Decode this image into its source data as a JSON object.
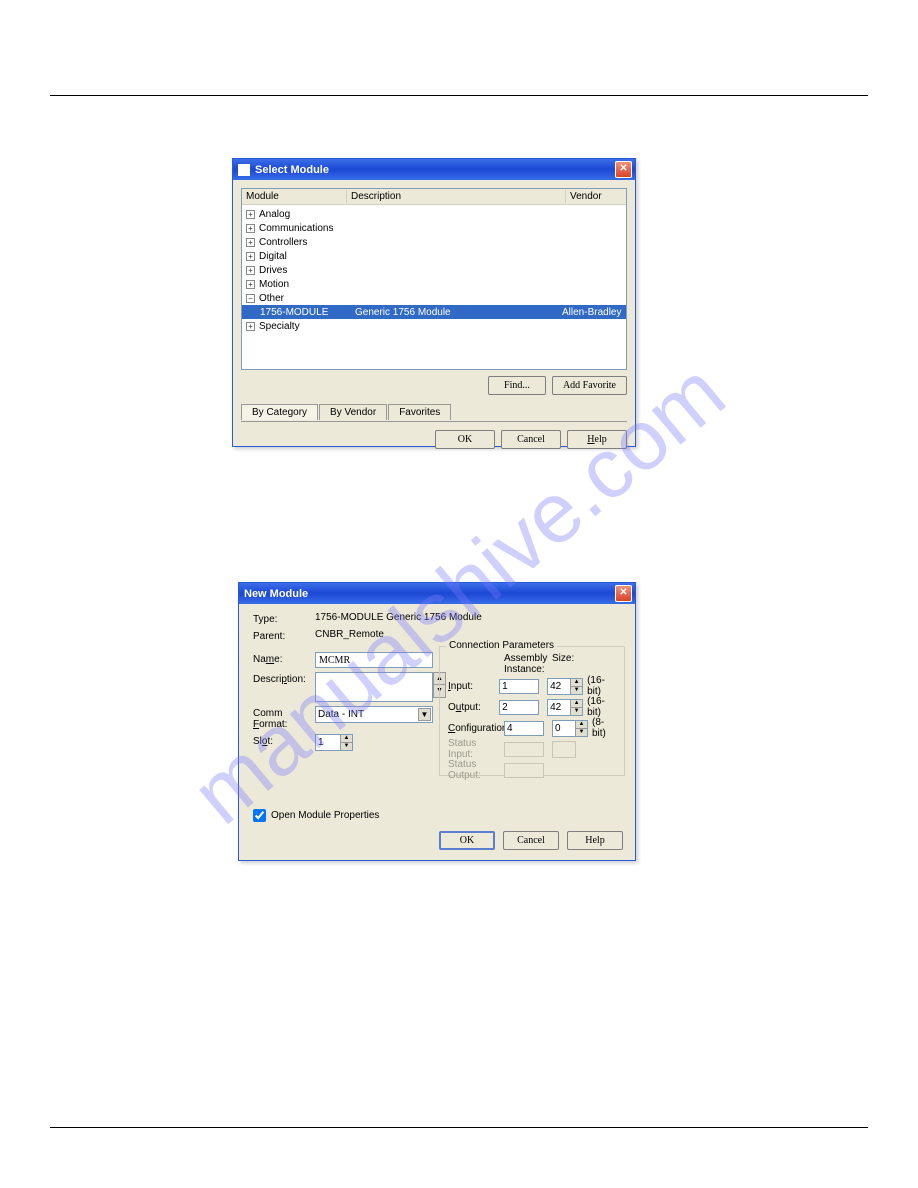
{
  "watermark": "manualshive.com",
  "selectModule": {
    "title": "Select Module",
    "columns": {
      "module": "Module",
      "description": "Description",
      "vendor": "Vendor"
    },
    "categories": [
      "Analog",
      "Communications",
      "Controllers",
      "Digital",
      "Drives",
      "Motion",
      "Other",
      "Specialty"
    ],
    "selected": {
      "name": "1756-MODULE",
      "description": "Generic 1756 Module",
      "vendor": "Allen-Bradley"
    },
    "findLabel": "Find...",
    "addFavoriteLabel": "Add Favorite",
    "tabByCategory": "By Category",
    "tabByVendor": "By Vendor",
    "tabFavorites": "Favorites",
    "okLabel": "OK",
    "cancelLabel": "Cancel",
    "helpLabel": "Help"
  },
  "newModule": {
    "title": "New Module",
    "typeLabel": "Type:",
    "typeValue": "1756-MODULE Generic 1756 Module",
    "parentLabel": "Parent:",
    "parentValue": "CNBR_Remote",
    "nameLabel": "Name:",
    "nameValue": "MCMR",
    "descriptionLabel": "Description:",
    "descriptionValue": "",
    "commFormatLabel": "Comm Format:",
    "commFormatValue": "Data - INT",
    "slotLabel": "Slot:",
    "slotValue": "1",
    "connParamsLegend": "Connection Parameters",
    "assemblyHeader": "Assembly\nInstance:",
    "sizeHeader": "Size:",
    "inputLabel": "Input:",
    "outputLabel": "Output:",
    "configLabel": "Configuration:",
    "statusInputLabel": "Status Input:",
    "statusOutputLabel": "Status Output:",
    "input": {
      "instance": "1",
      "size": "42",
      "unit": "(16-bit)"
    },
    "output": {
      "instance": "2",
      "size": "42",
      "unit": "(16-bit)"
    },
    "config": {
      "instance": "4",
      "size": "0",
      "unit": "(8-bit)"
    },
    "openPropsLabel": "Open Module Properties",
    "okLabel": "OK",
    "cancelLabel": "Cancel",
    "helpLabel": "Help"
  }
}
